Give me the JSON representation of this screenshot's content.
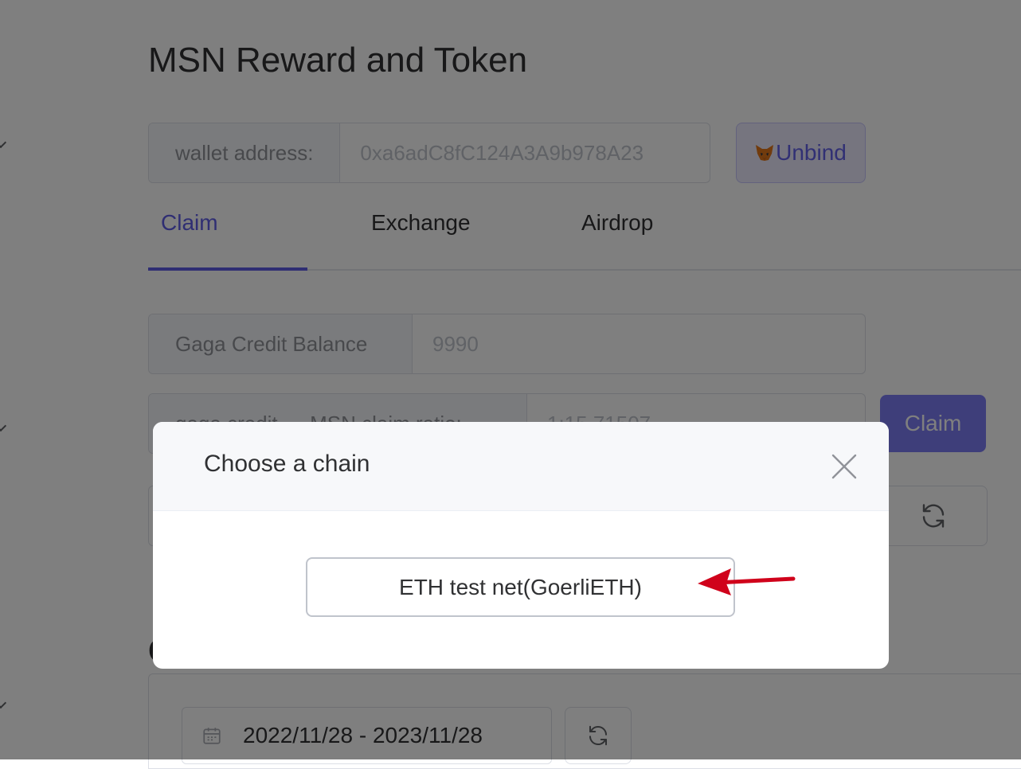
{
  "page": {
    "title": "MSN Reward and Token"
  },
  "wallet": {
    "label": "wallet address:",
    "value": "0xa6adC8fC124A3A9b978A23",
    "unbind_label": "Unbind",
    "unbind_icon": "metamask-fox-icon"
  },
  "tabs": [
    {
      "label": "Claim",
      "active": true
    },
    {
      "label": "Exchange",
      "active": false
    },
    {
      "label": "Airdrop",
      "active": false
    }
  ],
  "claim": {
    "balance_label": "Gaga Credit Balance",
    "balance_value": "9990",
    "ratio_label": "gaga credit → MSN claim ratio:",
    "ratio_value": "1:15.71507",
    "claim_button": "Claim"
  },
  "history": {
    "date_range": "2022/11/28 - 2023/11/28"
  },
  "dialog": {
    "title": "Choose a chain",
    "options": [
      {
        "label": "ETH test net(GoerliETH)"
      }
    ]
  },
  "colors": {
    "accent": "#5e5ce6",
    "arrow": "#d0021b",
    "overlay": "rgba(0,0,0,0.5)"
  }
}
